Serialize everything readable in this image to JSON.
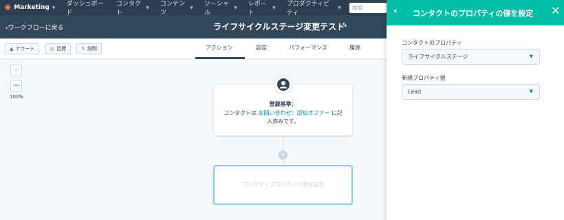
{
  "topnav": {
    "brand": "Marketing",
    "items": [
      "ダッシュボード",
      "コンタクト",
      "コンテンツ",
      "ソーシャル",
      "レポート",
      "プロダクティビティ"
    ],
    "search_placeholder": "検索"
  },
  "workflow": {
    "back_label": "ワークフローに戻る",
    "title": "ライフサイクルステージ変更テスト"
  },
  "toolbar": {
    "alert_label": "アラート",
    "goal_label": "目標",
    "description_label": "説明",
    "tabs": [
      "アクション",
      "設定",
      "パフォーマンス",
      "履歴"
    ]
  },
  "zoom": {
    "plus": "+",
    "minus": "−",
    "level": "100%"
  },
  "trigger_node": {
    "heading": "登録基準：",
    "text_before": "コンタクトは ",
    "link": "お問い合わせ：認知オファー",
    "text_after": " に記入済みです。"
  },
  "pending_node": {
    "label": "コンタクトプロパティの値を設定"
  },
  "panel": {
    "title": "コンタクトのプロパティの値を設定",
    "property_label": "コンタクトのプロパティ",
    "property_value": "ライフサイクルステージ",
    "new_value_label": "新規プロパティ値",
    "new_value": "Lead"
  },
  "colors": {
    "nav_bg": "#2d3e50",
    "header_bg": "#33475b",
    "panel_header": "#00bda5",
    "link": "#0091ae",
    "brand": "#ff7a59"
  }
}
